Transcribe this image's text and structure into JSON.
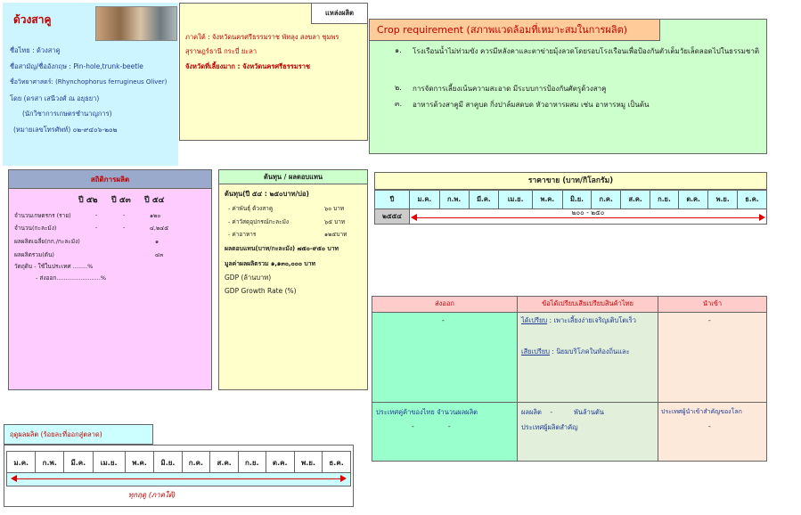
{
  "info": {
    "title": "ด้วงสาคู",
    "thai_name": "ชื่อไทย : ด้วงสาคู",
    "common_name": "ชื่อสามัญ/ชื่ออังกฤษ : Pin-hole,trunk-beetle",
    "sci_name": "ชื่อวิทยาศาสตร์: (Rhynchophorus ferrugineus Oliver)",
    "author": "โดย   (ดรสา เสนีวงศ์ ณ อยุธยา)",
    "author_role": "(นักวิชาการเกษตรชำนาญการ)",
    "phone": "(หมายเลขโทรศัพท์) ๐๒-๙๔๐๖-๒๐๒"
  },
  "source": {
    "header": "แหล่งผลิต",
    "region": "ภาคใต้ : จังหวัดนครศรีธรรมราช  พัทลุง  สงขลา ชุมพร",
    "region2": "สุราษฎร์ธานี กระบี่ ยะลา",
    "main_province": "จังหวัดที่เลี้ยงมาก : จังหวัดนครศรีธรรมราช"
  },
  "crop": {
    "header": "Crop requirement (สภาพแวดล้อมที่เหมาะสมในการผลิต)",
    "items": [
      {
        "num": "๑.",
        "text": "โรงเรือนน้ำไม่ท่วมขัง ควรมีหลังคาและตาข่ายมุ้งลวดโดยรอบโรงเรือนเพื่อป้องกันตัวเต็มวัยเล็ดลอดไปในธรรมชาติ"
      },
      {
        "num": "๒.",
        "text": "การจัดการเลี้ยงเน้นความสะอาด มีระบบการป้องกันศัตรูด้วงสาคู"
      },
      {
        "num": "๓.",
        "text": "อาหารด้วงสาคูมี สาคูบด กิ่งปาล์มสดบด หัวอาหารผสม เช่น อาหารหมู  เป็นต้น"
      }
    ]
  },
  "stats": {
    "header": "สถิติการผลิต",
    "years": [
      "ปี ๕๒",
      "ปี ๕๓",
      "ปี ๕๔"
    ],
    "rows": [
      {
        "label": "จำนวนเกษตรกร (ราย)",
        "v1": "-",
        "v2": "-",
        "v3": "๑๒๐"
      },
      {
        "label": "จำนวน(กะละมัง)",
        "v1": "-",
        "v2": "-",
        "v3": "๔,๒๔๕"
      },
      {
        "label": "ผลผลิตเฉลี่ย(กก./กะละมัง)",
        "v1": "",
        "v2": "",
        "v3": "๑"
      },
      {
        "label": "ผลผลิตรวม(ตัน)",
        "v1": "",
        "v2": "",
        "v3": "๔๓"
      }
    ],
    "ratio_line1": "วัตถุดิบ - ใช้ในประเทศ  ........%",
    "ratio_line2": "- ส่งออก........................%"
  },
  "cost": {
    "header": "ต้นทุน / ผลตอบแทน",
    "line1": "ต้นทุน(ปี ๕๔ : ๒๕๐บาท/บ่อ)",
    "lines": [
      {
        "label": "- ค่าพันธุ์ ด้วงสาคู",
        "value": "๖๐ บาท"
      },
      {
        "label": "- ค่าวัสดุอุปกรณ์กะละมัง",
        "value": "๖๕ บาท"
      },
      {
        "label": "- ค่าอาหาร",
        "value": "๑๒๕บาท"
      }
    ],
    "return": "ผลตอบแทน(บาท/กะละมัง)   ๗๕๐-๙๕๐ บาท",
    "total": "มูลค่าผลผลิตรวม   ๑,๑๓๐,๐๐๐ บาท",
    "gdp": "GDP (ล้านบาท)",
    "gdp_growth": "GDP Growth Rate (%)"
  },
  "price": {
    "header": "ราคาขาย (บาท/กิโลกรัม)",
    "year_col": "ปี",
    "months": [
      "ม.ค.",
      "ก.พ.",
      "มี.ค.",
      "เม.ย.",
      "พ.ค.",
      "มิ.ย.",
      "ก.ค.",
      "ส.ค.",
      "ก.ย.",
      "ต.ค.",
      "พ.ย.",
      "ธ.ค."
    ],
    "year": "๒๕๕๔",
    "range": "๒๐๐ - ๒๕๐"
  },
  "trade": {
    "export_header": "ส่งออก",
    "advantage_header": "ข้อได้เปรียบเสียเปรียบสินค้าไทย",
    "import_header": "นำเข้า",
    "export_value": "-",
    "import_value": "-",
    "adv_label": "ได้เปรียบ",
    "adv_text": " : เพาะเลี้ยงง่ายเจริญเติบโตเร็ว",
    "disadv_label": "เสียเปรียบ",
    "disadv_text": " : นิยมบริโภคในท้องถิ่นและ",
    "export_countries": "ประเทศคู่ค้าของไทย  จำนวนผลผลิต",
    "export_countries_value": "-                -",
    "competitor_line": "ผลผลิต    -          พันล้านตัน",
    "competitor_line2": "ประเทศผู้ผลิตสำคัญ",
    "import_countries": "ประเทศผู้นำเข้าสำคัญของโลก",
    "import_countries_value": "-"
  },
  "season": {
    "header": "ฤดูผลผลิต (ร้อยละที่ออกสู่ตลาด)",
    "months": [
      "ม.ค.",
      "ก.พ.",
      "มี.ค.",
      "เม.ย.",
      "พ.ค.",
      "มิ.ย.",
      "ก.ค.",
      "ส.ค.",
      "ก.ย.",
      "ต.ค.",
      "พ.ย.",
      "ธ.ค."
    ],
    "label": "ทุกฤดู  (ภาคใต้)"
  }
}
